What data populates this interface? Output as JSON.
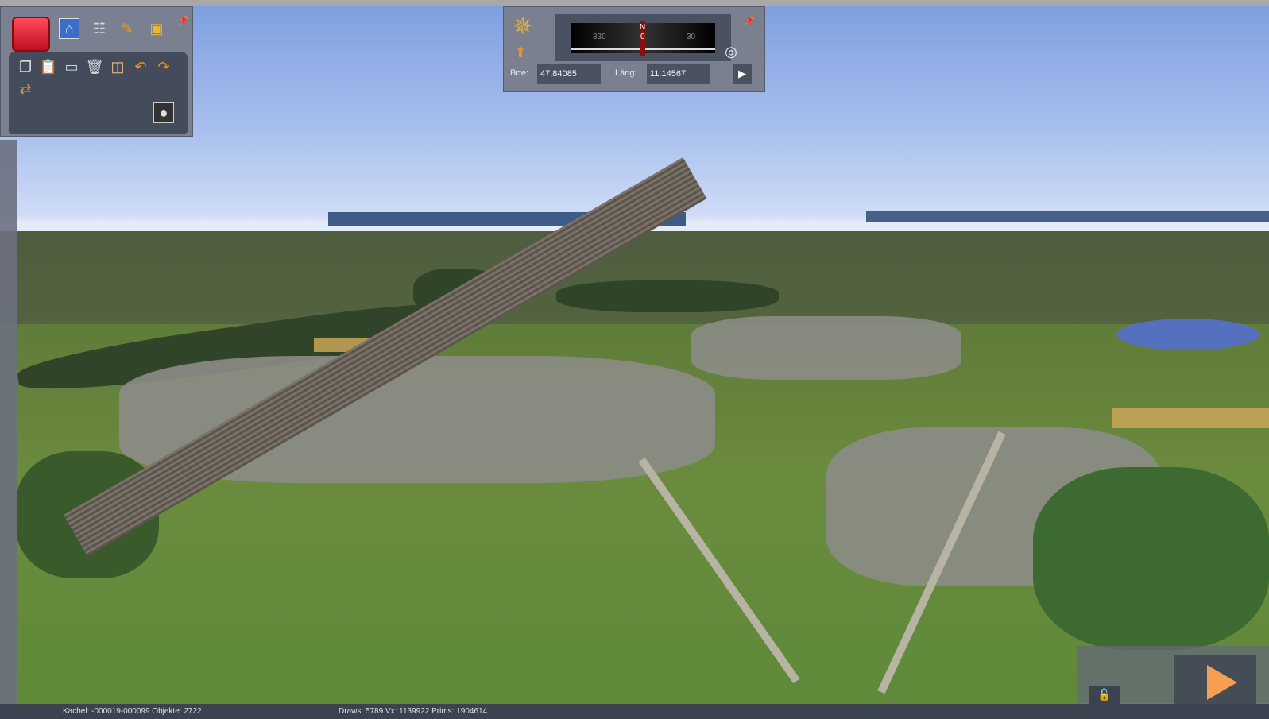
{
  "toolbar": {
    "icons": [
      "toolbox-icon",
      "home-icon",
      "track-icon",
      "paint-brush-icon",
      "train-icon",
      "pin-icon",
      "copy-icon",
      "paste-icon",
      "display-icon",
      "trash-icon",
      "measure-icon",
      "undo-icon",
      "redo-icon",
      "bulldozer-icon",
      "brush-shape-icon"
    ]
  },
  "compass": {
    "heading_label": "N",
    "heading_value": "0",
    "tick_left": "330",
    "tick_right": "30",
    "lat_label": "Brte:",
    "lat_value": "47.84085",
    "lon_label": "Läng:",
    "lon_value": "11.14567"
  },
  "status": {
    "tile": "Kachel: -000019-000099  Objekte: 2722",
    "render": "Draws: 5789 Vx: 1139922 Prims: 1904614"
  },
  "colors": {
    "accent": "#f4a050",
    "panel": "#6c7282"
  }
}
